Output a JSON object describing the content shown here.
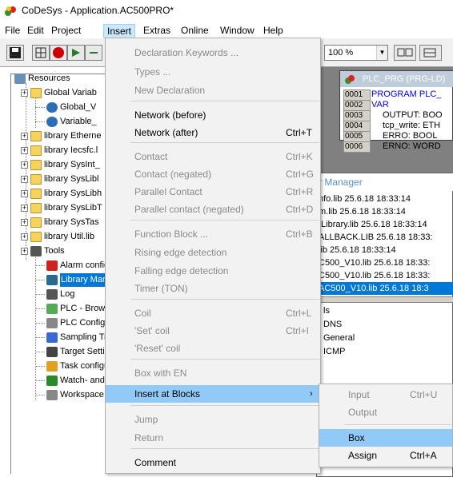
{
  "window": {
    "title": "CoDeSys - Application.AC500PRO*"
  },
  "menubar": {
    "items": [
      "File",
      "Edit",
      "Project",
      "Insert",
      "Extras",
      "Online",
      "Window",
      "Help"
    ]
  },
  "toolbar": {
    "zoom": "100 %"
  },
  "tree": {
    "items": [
      "Resources",
      "Global Variab",
      "Global_V",
      "Variable_",
      "library Etherne",
      "library Iecsfc.l",
      "library SysInt_",
      "library SysLibl",
      "library SysLibh",
      "library SysLibT",
      "library SysTas",
      "library Util.lib",
      "Tools",
      "Alarm configu",
      "Library Manag",
      "Log",
      "PLC - Browse",
      "PLC Configura",
      "Sampling Tra",
      "Target Setting",
      "Task configur",
      "Watch- and F",
      "Workspace"
    ]
  },
  "plc_window": {
    "title": "PLC_PRG (PRG-LD)",
    "lines": [
      {
        "num": "0001",
        "text": "PROGRAM PLC_"
      },
      {
        "num": "0002",
        "text": "VAR"
      },
      {
        "num": "0003",
        "text": "OUTPUT: BOO"
      },
      {
        "num": "0004",
        "text": "tcp_write: ETH"
      },
      {
        "num": "0005",
        "text": "ERRO: BOOL"
      },
      {
        "num": "0006",
        "text": "ERNO: WORD"
      }
    ]
  },
  "library_manager": {
    "title": "y Manager",
    "libraries": [
      "nfo.lib 25.6.18 18:33:14",
      "m.lib 25.6.18 18:33:14",
      "tLibrary.lib 25.6.18 18:33:14",
      "ALLBACK.LIB 25.6.18 18:33:",
      "lib 25.6.18 18:33:14",
      "C500_V10.lib 25.6.18 18:33:",
      "C500_V10.lib 25.6.18 18:33:",
      "AC500_V10.lib 25.6.18 18:3"
    ],
    "pous": [
      "ls",
      "DNS",
      "General",
      "ICMP"
    ]
  },
  "insert_menu": {
    "items": [
      {
        "label": "Declaration Keywords ...",
        "shortcut": "",
        "disabled": true
      },
      {
        "label": "Types ...",
        "shortcut": "",
        "disabled": true
      },
      {
        "label": "New Declaration",
        "shortcut": "",
        "disabled": true
      },
      {
        "label": "Network (before)",
        "shortcut": "",
        "disabled": false
      },
      {
        "label": "Network (after)",
        "shortcut": "Ctrl+T",
        "disabled": false
      },
      {
        "label": "Contact",
        "shortcut": "Ctrl+K",
        "disabled": true
      },
      {
        "label": "Contact (negated)",
        "shortcut": "Ctrl+G",
        "disabled": true
      },
      {
        "label": "Parallel Contact",
        "shortcut": "Ctrl+R",
        "disabled": true
      },
      {
        "label": "Parallel contact (negated)",
        "shortcut": "Ctrl+D",
        "disabled": true
      },
      {
        "label": "Function Block ...",
        "shortcut": "Ctrl+B",
        "disabled": true
      },
      {
        "label": "Rising edge detection",
        "shortcut": "",
        "disabled": true
      },
      {
        "label": "Falling edge detection",
        "shortcut": "",
        "disabled": true
      },
      {
        "label": "Timer (TON)",
        "shortcut": "",
        "disabled": true
      },
      {
        "label": "Coil",
        "shortcut": "Ctrl+L",
        "disabled": true
      },
      {
        "label": "'Set' coil",
        "shortcut": "Ctrl+I",
        "disabled": true
      },
      {
        "label": "'Reset' coil",
        "shortcut": "",
        "disabled": true
      },
      {
        "label": "Box with EN",
        "shortcut": "",
        "disabled": true
      },
      {
        "label": "Insert at Blocks",
        "shortcut": "",
        "disabled": false,
        "submenu": true
      },
      {
        "label": "Jump",
        "shortcut": "",
        "disabled": true
      },
      {
        "label": "Return",
        "shortcut": "",
        "disabled": true
      },
      {
        "label": "Comment",
        "shortcut": "",
        "disabled": false
      }
    ]
  },
  "submenu": {
    "items": [
      {
        "label": "Input",
        "shortcut": "Ctrl+U",
        "disabled": true
      },
      {
        "label": "Output",
        "shortcut": "",
        "disabled": true
      },
      {
        "label": "Box",
        "shortcut": "",
        "disabled": false
      },
      {
        "label": "Assign",
        "shortcut": "Ctrl+A",
        "disabled": false
      }
    ]
  }
}
